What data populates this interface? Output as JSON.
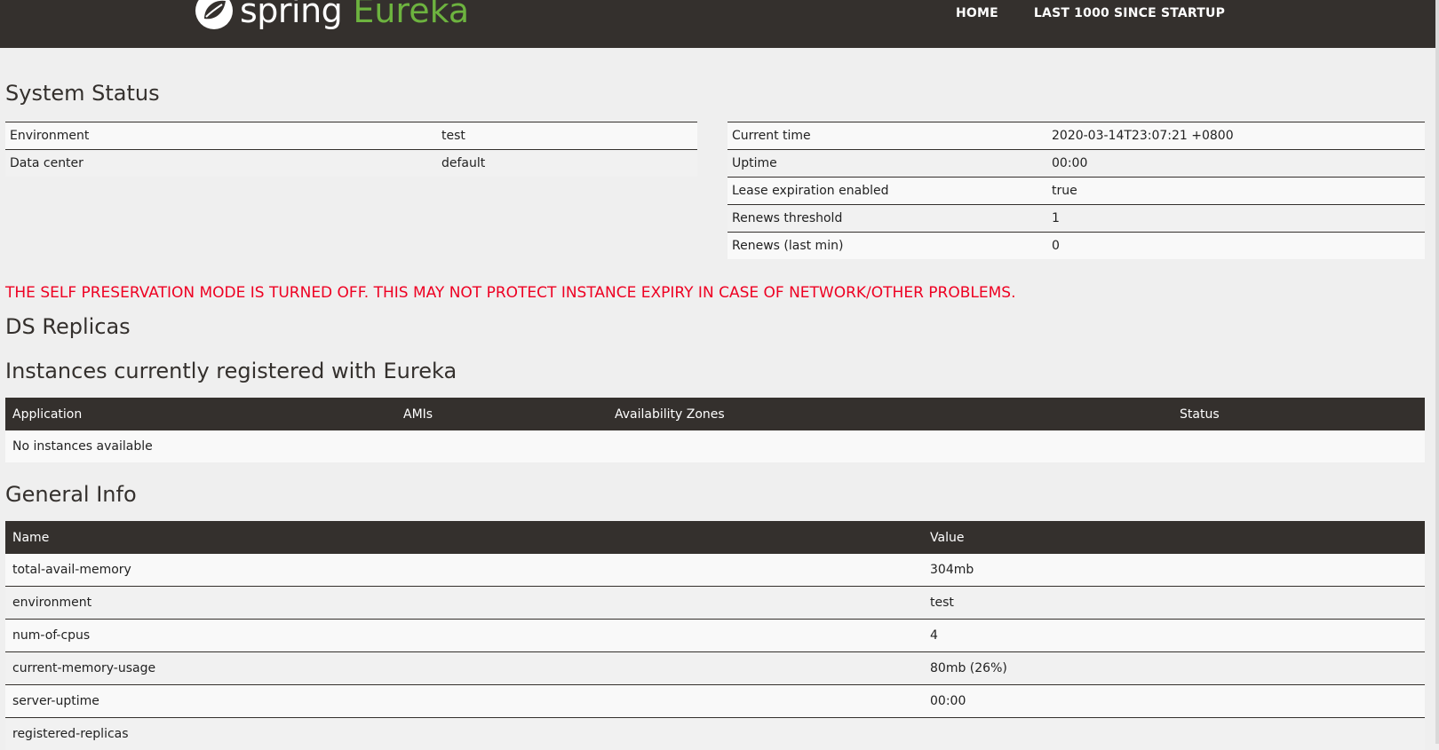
{
  "navbar": {
    "brand_spring": "spring",
    "brand_eureka": "Eureka",
    "links": [
      "HOME",
      "LAST 1000 SINCE STARTUP"
    ]
  },
  "system_status": {
    "title": "System Status",
    "left": [
      {
        "key": "Environment",
        "value": "test"
      },
      {
        "key": "Data center",
        "value": "default"
      }
    ],
    "right": [
      {
        "key": "Current time",
        "value": "2020-03-14T23:07:21 +0800"
      },
      {
        "key": "Uptime",
        "value": "00:00"
      },
      {
        "key": "Lease expiration enabled",
        "value": "true"
      },
      {
        "key": "Renews threshold",
        "value": "1"
      },
      {
        "key": "Renews (last min)",
        "value": "0"
      }
    ]
  },
  "warning": "THE SELF PRESERVATION MODE IS TURNED OFF. THIS MAY NOT PROTECT INSTANCE EXPIRY IN CASE OF NETWORK/OTHER PROBLEMS.",
  "ds_replicas": {
    "title": "DS Replicas"
  },
  "instances": {
    "title": "Instances currently registered with Eureka",
    "columns": [
      "Application",
      "AMIs",
      "Availability Zones",
      "Status"
    ],
    "empty_text": "No instances available"
  },
  "general_info": {
    "title": "General Info",
    "columns": [
      "Name",
      "Value"
    ],
    "rows": [
      {
        "name": "total-avail-memory",
        "value": "304mb"
      },
      {
        "name": "environment",
        "value": "test"
      },
      {
        "name": "num-of-cpus",
        "value": "4"
      },
      {
        "name": "current-memory-usage",
        "value": "80mb (26%)"
      },
      {
        "name": "server-uptime",
        "value": "00:00"
      },
      {
        "name": "registered-replicas",
        "value": ""
      }
    ]
  },
  "colors": {
    "navbar_bg": "#34302d",
    "brand_green": "#6db33f",
    "warning_red": "#ee0022",
    "page_bg": "#efefef"
  }
}
